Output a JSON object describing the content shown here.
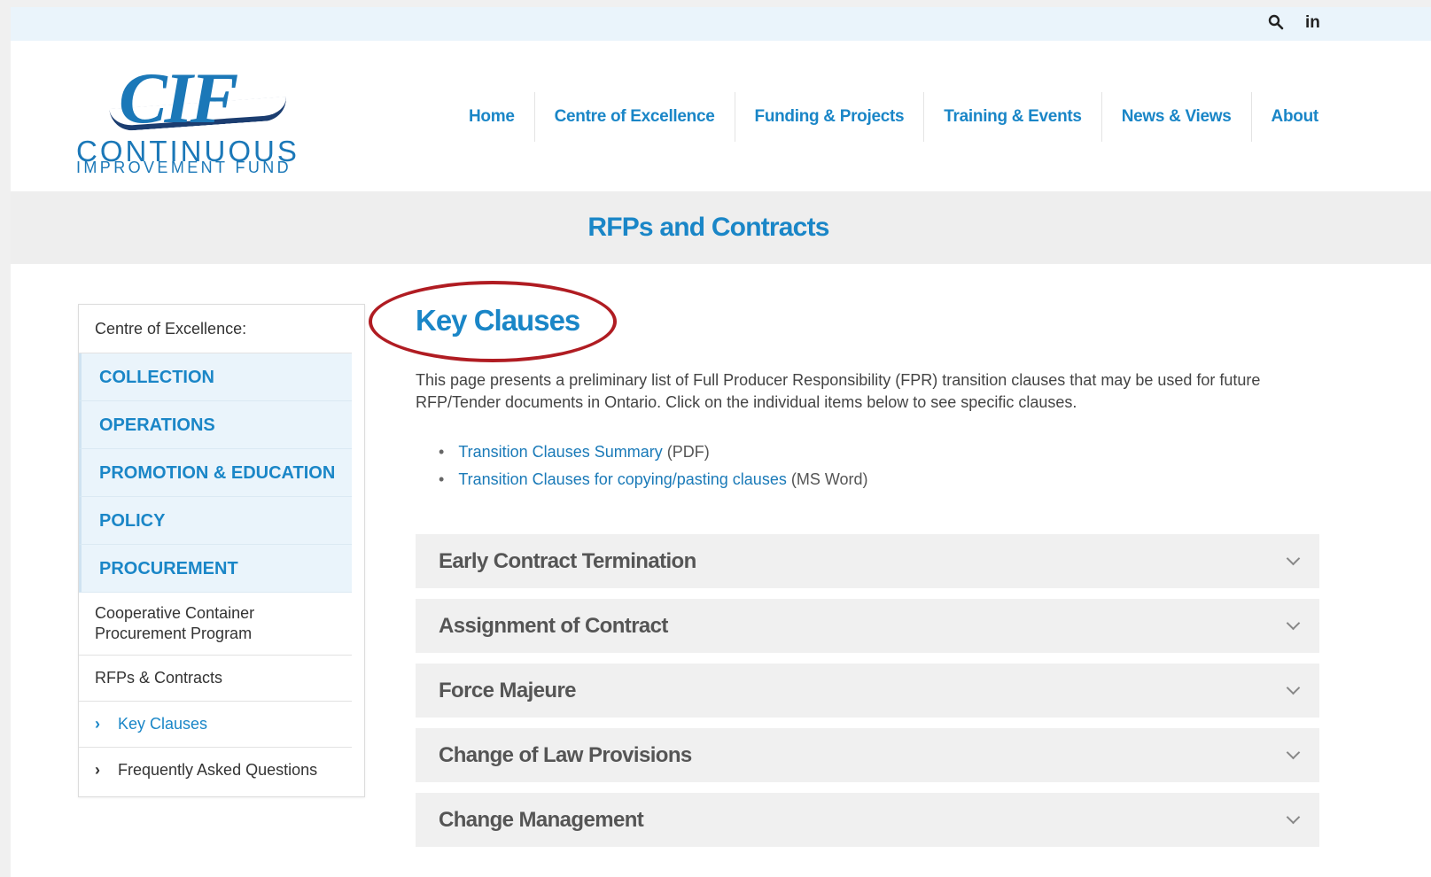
{
  "topbar": {
    "search_icon": "search-icon",
    "linkedin_label": "in"
  },
  "logo": {
    "mark": "CIF",
    "line1": "CONTINUOUS",
    "line2": "IMPROVEMENT FUND"
  },
  "nav": {
    "items": [
      "Home",
      "Centre of Excellence",
      "Funding & Projects",
      "Training & Events",
      "News & Views",
      "About"
    ]
  },
  "banner": {
    "title": "RFPs and Contracts"
  },
  "sidebar": {
    "heading": "Centre of Excellence:",
    "categories": [
      "COLLECTION",
      "OPERATIONS",
      "PROMOTION & EDUCATION",
      "POLICY",
      "PROCUREMENT"
    ],
    "subitems": [
      "Cooperative Container Procurement Program",
      "RFPs & Contracts",
      "Key Clauses",
      "Frequently Asked Questions"
    ]
  },
  "main": {
    "title": "Key Clauses",
    "intro": "This page presents a preliminary list of Full Producer Responsibility (FPR) transition clauses that may be used for future RFP/Tender documents in Ontario. Click on the individual items below to see specific clauses.",
    "links": [
      {
        "label": "Transition Clauses Summary",
        "suffix": " (PDF)"
      },
      {
        "label": "Transition Clauses for copying/pasting clauses",
        "suffix": " (MS Word)"
      }
    ],
    "accordion": [
      "Early Contract Termination",
      "Assignment of Contract",
      "Force Majeure",
      "Change of Law Provisions",
      "Change Management"
    ]
  },
  "colors": {
    "accent": "#1a86c7",
    "highlight": "#b01c22",
    "topbar": "#eaf4fb"
  }
}
